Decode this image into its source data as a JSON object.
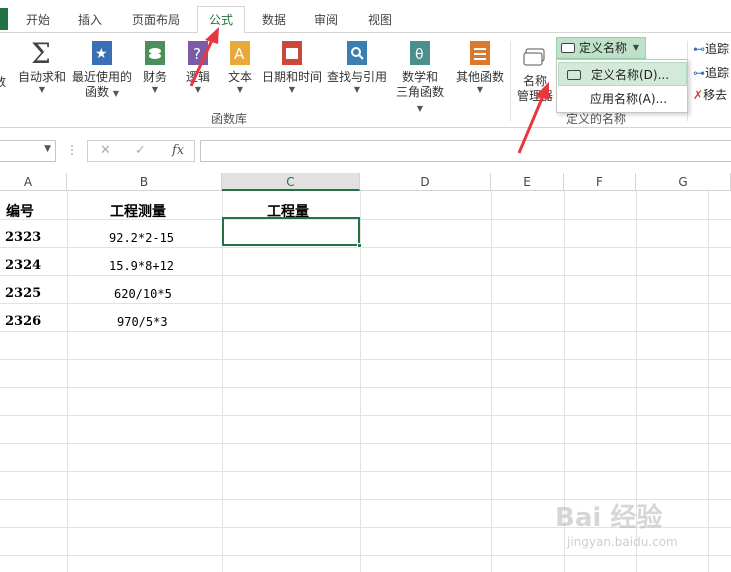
{
  "ribbon_tabs": [
    "开始",
    "插入",
    "页面布局",
    "公式",
    "数据",
    "审阅",
    "视图"
  ],
  "active_tab": "公式",
  "ribbon_buttons": {
    "left_cut": "数",
    "autosum": "自动求和",
    "recent": "最近使用的",
    "recent2": "函数",
    "finance": "财务",
    "logic": "逻辑",
    "text": "文本",
    "datetime": "日期和时间",
    "lookup": "查找与引用",
    "math": "数学和",
    "math2": "三角函数",
    "other": "其他函数",
    "name_mgr": "名称",
    "name_mgr2": "管理器"
  },
  "group_labels": {
    "function_library": "函数库",
    "defined_names": "定义的名称"
  },
  "define_name_button": "定义名称",
  "menu_items": [
    "定义名称(D)...",
    "应用名称(A)..."
  ],
  "right_items": [
    "追踪",
    "追踪",
    "移去"
  ],
  "formula_bar": {
    "name_box": "",
    "fx": "fx",
    "cancel": "✕",
    "confirm": "✓",
    "dots": "⋮"
  },
  "columns": [
    "A",
    "B",
    "C",
    "D",
    "E",
    "F",
    "G"
  ],
  "selected_column": "C",
  "table": {
    "headers": [
      "编号",
      "工程测量",
      "工程量"
    ],
    "rows": [
      [
        "2323",
        "92.2*2-15"
      ],
      [
        "2324",
        "15.9*8+12"
      ],
      [
        "2325",
        "620/10*5"
      ],
      [
        "2326",
        "970/5*3"
      ]
    ]
  },
  "watermark": "Bai 经验",
  "watermark_sub": "jingyan.baidu.com",
  "colors": {
    "excel_green": "#217346",
    "arrow_red": "#e8373e"
  }
}
